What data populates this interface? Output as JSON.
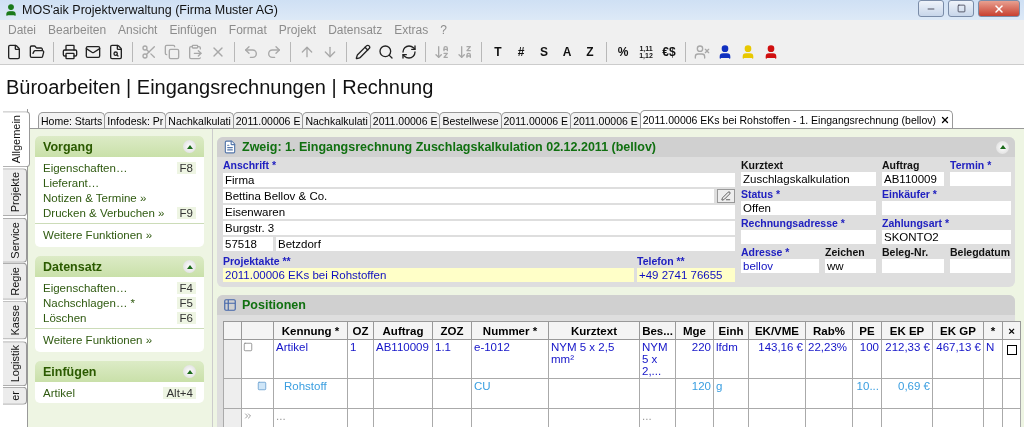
{
  "window": {
    "title": "MOS'aik Projektverwaltung (Firma Muster AG)"
  },
  "menu": [
    {
      "label": "Datei",
      "disabled": true
    },
    {
      "label": "Bearbeiten",
      "disabled": true
    },
    {
      "label": "Ansicht",
      "disabled": true
    },
    {
      "label": "Einfügen",
      "disabled": true
    },
    {
      "label": "Format",
      "disabled": true
    },
    {
      "label": "Projekt",
      "disabled": true
    },
    {
      "label": "Datensatz",
      "disabled": true
    },
    {
      "label": "Extras",
      "disabled": true
    },
    {
      "label": "?",
      "disabled": true
    }
  ],
  "toolbar": [
    {
      "kind": "icon",
      "disabled": false
    },
    {
      "kind": "icon",
      "disabled": false
    },
    {
      "kind": "separator"
    },
    {
      "kind": "icon",
      "disabled": false
    },
    {
      "kind": "icon",
      "disabled": false
    },
    {
      "kind": "icon",
      "disabled": false
    },
    {
      "kind": "separator"
    },
    {
      "kind": "icon",
      "disabled": true
    },
    {
      "kind": "icon",
      "disabled": true
    },
    {
      "kind": "icon",
      "disabled": true
    },
    {
      "kind": "icon",
      "disabled": true
    },
    {
      "kind": "separator"
    },
    {
      "kind": "icon",
      "disabled": true
    },
    {
      "kind": "icon",
      "disabled": true
    },
    {
      "kind": "separator"
    },
    {
      "kind": "icon",
      "disabled": true
    },
    {
      "kind": "icon",
      "disabled": true
    },
    {
      "kind": "separator"
    },
    {
      "kind": "icon",
      "disabled": false
    },
    {
      "kind": "icon",
      "disabled": false
    },
    {
      "kind": "icon",
      "disabled": false
    },
    {
      "kind": "separator"
    },
    {
      "kind": "icon",
      "disabled": true
    },
    {
      "kind": "icon",
      "disabled": true
    },
    {
      "kind": "separator"
    },
    {
      "kind": "text",
      "label": "T",
      "disabled": false
    },
    {
      "kind": "text",
      "label": "#",
      "disabled": false
    },
    {
      "kind": "text",
      "label": "S",
      "disabled": false
    },
    {
      "kind": "text",
      "label": "A",
      "disabled": false
    },
    {
      "kind": "text",
      "label": "Z",
      "disabled": false
    },
    {
      "kind": "separator"
    },
    {
      "kind": "text",
      "label": "%",
      "disabled": false
    },
    {
      "kind": "text",
      "label": "1,11 1,12",
      "disabled": false
    },
    {
      "kind": "text",
      "label": "€$",
      "disabled": false
    },
    {
      "kind": "separator"
    },
    {
      "kind": "icon",
      "disabled": true
    },
    {
      "kind": "icon",
      "disabled": false,
      "color": "#1030c0"
    },
    {
      "kind": "icon",
      "disabled": false,
      "color": "#e8c800"
    },
    {
      "kind": "icon",
      "disabled": false,
      "color": "#d01010"
    }
  ],
  "heading": "Büroarbeiten | Eingangsrechnungen | Rechnung",
  "side_tabs": [
    {
      "label": "Allgemein",
      "selected": true
    },
    {
      "label": "Projekte",
      "selected": false
    },
    {
      "label": "Service",
      "selected": false
    },
    {
      "label": "Regie",
      "selected": false
    },
    {
      "label": "Kasse",
      "selected": false
    },
    {
      "label": "Logistik",
      "selected": false
    },
    {
      "label": "er",
      "selected": false
    }
  ],
  "tabs": [
    {
      "label": "Home: Starts",
      "selected": false
    },
    {
      "label": "Infodesk: Pr",
      "selected": false
    },
    {
      "label": "Nachkalkulati",
      "selected": false
    },
    {
      "label": "2011.00006 E",
      "selected": false
    },
    {
      "label": "Nachkalkulati",
      "selected": false
    },
    {
      "label": "2011.00006 E",
      "selected": false
    },
    {
      "label": "Bestellwese",
      "selected": false
    },
    {
      "label": "2011.00006 E",
      "selected": false
    },
    {
      "label": "2011.00006 E",
      "selected": false
    },
    {
      "label": "2011.00006 EKs bei Rohstoffen - 1. Eingangsrechnung (bellov)",
      "selected": true
    }
  ],
  "sidebar": [
    {
      "title": "Vorgang",
      "expanded": true,
      "items": [
        {
          "label": "Eigenschaften…",
          "shortcut": "F8"
        },
        {
          "label": "Lieferant…"
        },
        {
          "label": "Notizen & Termine »"
        },
        {
          "label": "Drucken & Verbuchen »",
          "shortcut": "F9"
        }
      ],
      "more": "Weitere Funktionen »"
    },
    {
      "title": "Datensatz",
      "expanded": true,
      "items": [
        {
          "label": "Eigenschaften…",
          "shortcut": "F4"
        },
        {
          "label": "Nachschlagen… *",
          "shortcut": "F5"
        },
        {
          "label": "Löschen",
          "shortcut": "F6"
        }
      ],
      "more": "Weitere Funktionen »"
    },
    {
      "title": "Einfügen",
      "expanded": true,
      "items": [
        {
          "label": "Artikel",
          "shortcut": "Alt+4"
        }
      ]
    }
  ],
  "form": {
    "title": "Zweig: 1. Eingangsrechnung Zuschlagskalkulation 02.12.2011 (bellov)",
    "expanded": true,
    "address": {
      "label": "Anschrift *",
      "lines": [
        "Firma",
        "Bettina Bellov & Co.",
        "Eisenwaren",
        "Burgstr. 3"
      ],
      "zip": "57518",
      "city": "Betzdorf"
    },
    "project": {
      "label": "Projektakte **",
      "value": "2011.00006 EKs bei Rohstoffen"
    },
    "phone": {
      "label": "Telefon **",
      "value": "+49 2741 76655"
    },
    "fields": [
      {
        "label": "Kurztext",
        "required": false,
        "value": "Zuschlagskalkulation"
      },
      {
        "label": "Auftrag",
        "required": false,
        "value": "AB110009"
      },
      {
        "label": "Termin *",
        "required": true
      },
      {
        "label": "Status *",
        "required": true,
        "value": "Offen"
      },
      {
        "label": "Einkäufer *",
        "required": true
      },
      {
        "label": "Rechnungsadresse *",
        "required": true
      },
      {
        "label": "Zahlungsart *",
        "required": true,
        "value": "SKONTO2"
      },
      {
        "label": "Adresse *",
        "required": true,
        "value": "bellov",
        "linked": true
      },
      {
        "label": "Zeichen",
        "required": false,
        "value": "ww"
      },
      {
        "label": "Beleg-Nr.",
        "required": false
      },
      {
        "label": "Belegdatum",
        "required": false
      }
    ]
  },
  "positions": {
    "title": "Positionen",
    "columns": [
      "Kennung *",
      "OZ",
      "Auftrag",
      "ZOZ",
      "Nummer *",
      "Kurztext",
      "Bes...",
      "Mge",
      "Einh",
      "EK/VME",
      "Rab%",
      "PE",
      "EK EP",
      "EK GP",
      "*",
      "×"
    ],
    "rows": [
      {
        "kind": "article",
        "expanded": true,
        "checked": false,
        "cells": [
          "Artikel",
          "1",
          "AB110009",
          "1.1",
          "e-1012",
          "NYM 5 x 2,5 mm²",
          "NYM 5 x 2,...",
          "220",
          "lfdm",
          "143,16 €",
          "22,23%",
          "100",
          "212,33 €",
          "467,13 €",
          "N"
        ]
      },
      {
        "kind": "material",
        "cells": [
          "Rohstoff",
          "",
          "",
          "",
          "CU",
          "",
          "",
          "120",
          "g",
          "",
          "",
          "10...",
          "0,69 €",
          "",
          ""
        ]
      },
      {
        "kind": "new",
        "cells": [
          "...",
          "",
          "",
          "",
          "",
          "",
          "...",
          "",
          "",
          "",
          "",
          "",
          "",
          "",
          ""
        ]
      }
    ]
  }
}
